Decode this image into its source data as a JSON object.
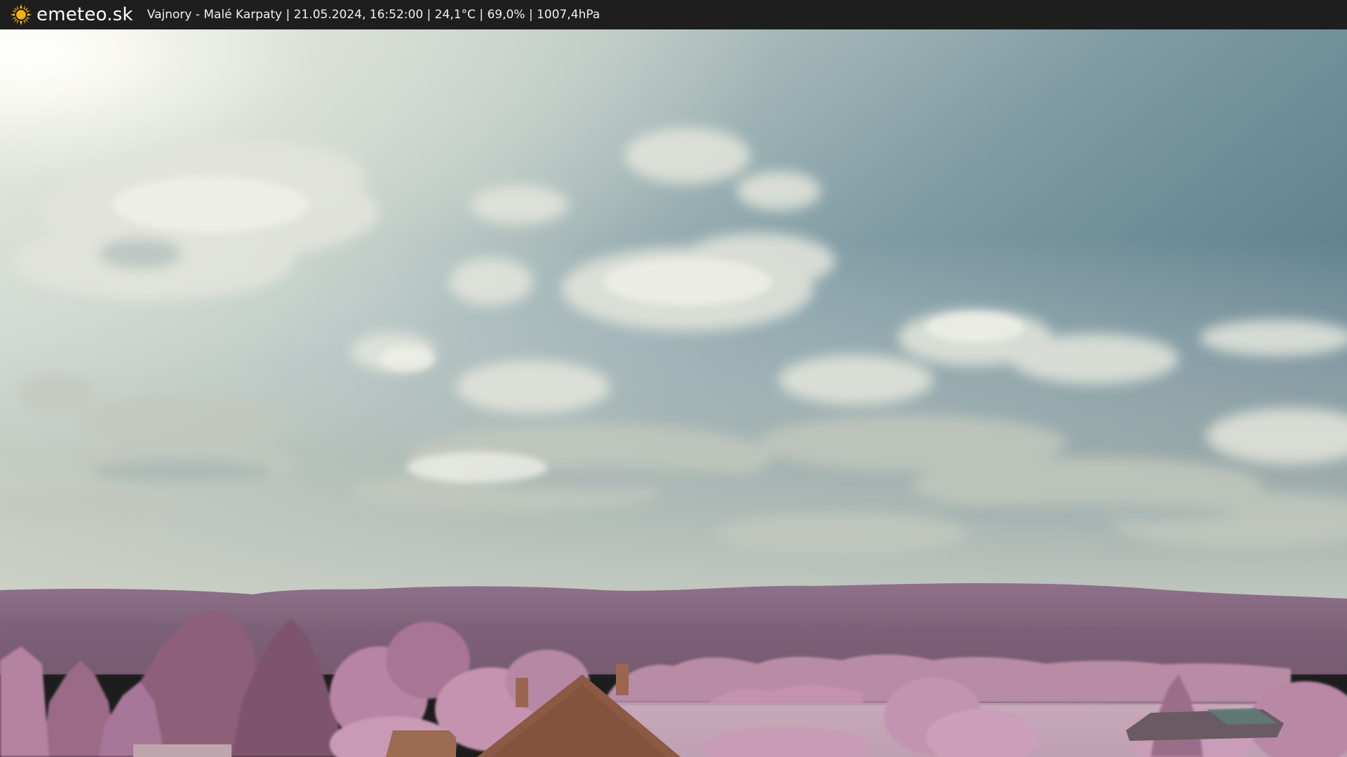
{
  "overlay": {
    "brand": "emeteo.sk",
    "logo_icon": "sun-icon",
    "info": "Vajnory - Malé Karpaty | 21.05.2024, 16:52:00 | 24,1°C | 69,0% | 1007,4hPa"
  },
  "colors": {
    "bar": "#1e1e1e",
    "sun_yellow": "#f6b400",
    "sky_top": "#5e7f8e",
    "sky_bright": "#e9ede4",
    "foliage": "#b98aa2",
    "hills": "#8a6a82",
    "field": "#c9aebb",
    "roof": "#8c5a44"
  }
}
